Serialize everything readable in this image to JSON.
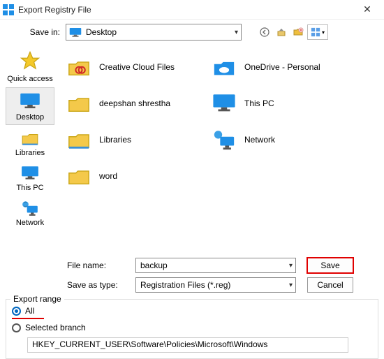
{
  "window": {
    "title": "Export Registry File"
  },
  "savein": {
    "label": "Save in:",
    "value": "Desktop"
  },
  "places": [
    {
      "key": "quick_access",
      "label": "Quick access"
    },
    {
      "key": "desktop",
      "label": "Desktop"
    },
    {
      "key": "libraries",
      "label": "Libraries"
    },
    {
      "key": "thispc",
      "label": "This PC"
    },
    {
      "key": "network",
      "label": "Network"
    }
  ],
  "files": [
    {
      "key": "creative",
      "label": "Creative Cloud Files",
      "icon": "folder-creative"
    },
    {
      "key": "onedrive",
      "label": "OneDrive - Personal",
      "icon": "folder-onedrive"
    },
    {
      "key": "deepshan",
      "label": "deepshan shrestha",
      "icon": "folder"
    },
    {
      "key": "thispc",
      "label": "This PC",
      "icon": "thispc"
    },
    {
      "key": "libraries",
      "label": "Libraries",
      "icon": "folder-libs"
    },
    {
      "key": "network",
      "label": "Network",
      "icon": "network"
    },
    {
      "key": "word",
      "label": "word",
      "icon": "folder"
    }
  ],
  "filename": {
    "label": "File name:",
    "value": "backup"
  },
  "filetype": {
    "label": "Save as type:",
    "value": "Registration Files (*.reg)"
  },
  "buttons": {
    "save": "Save",
    "cancel": "Cancel"
  },
  "export": {
    "legend": "Export range",
    "opt_all": "All",
    "opt_selected": "Selected branch",
    "selected": "all",
    "branch_path": "HKEY_CURRENT_USER\\Software\\Policies\\Microsoft\\Windows"
  }
}
